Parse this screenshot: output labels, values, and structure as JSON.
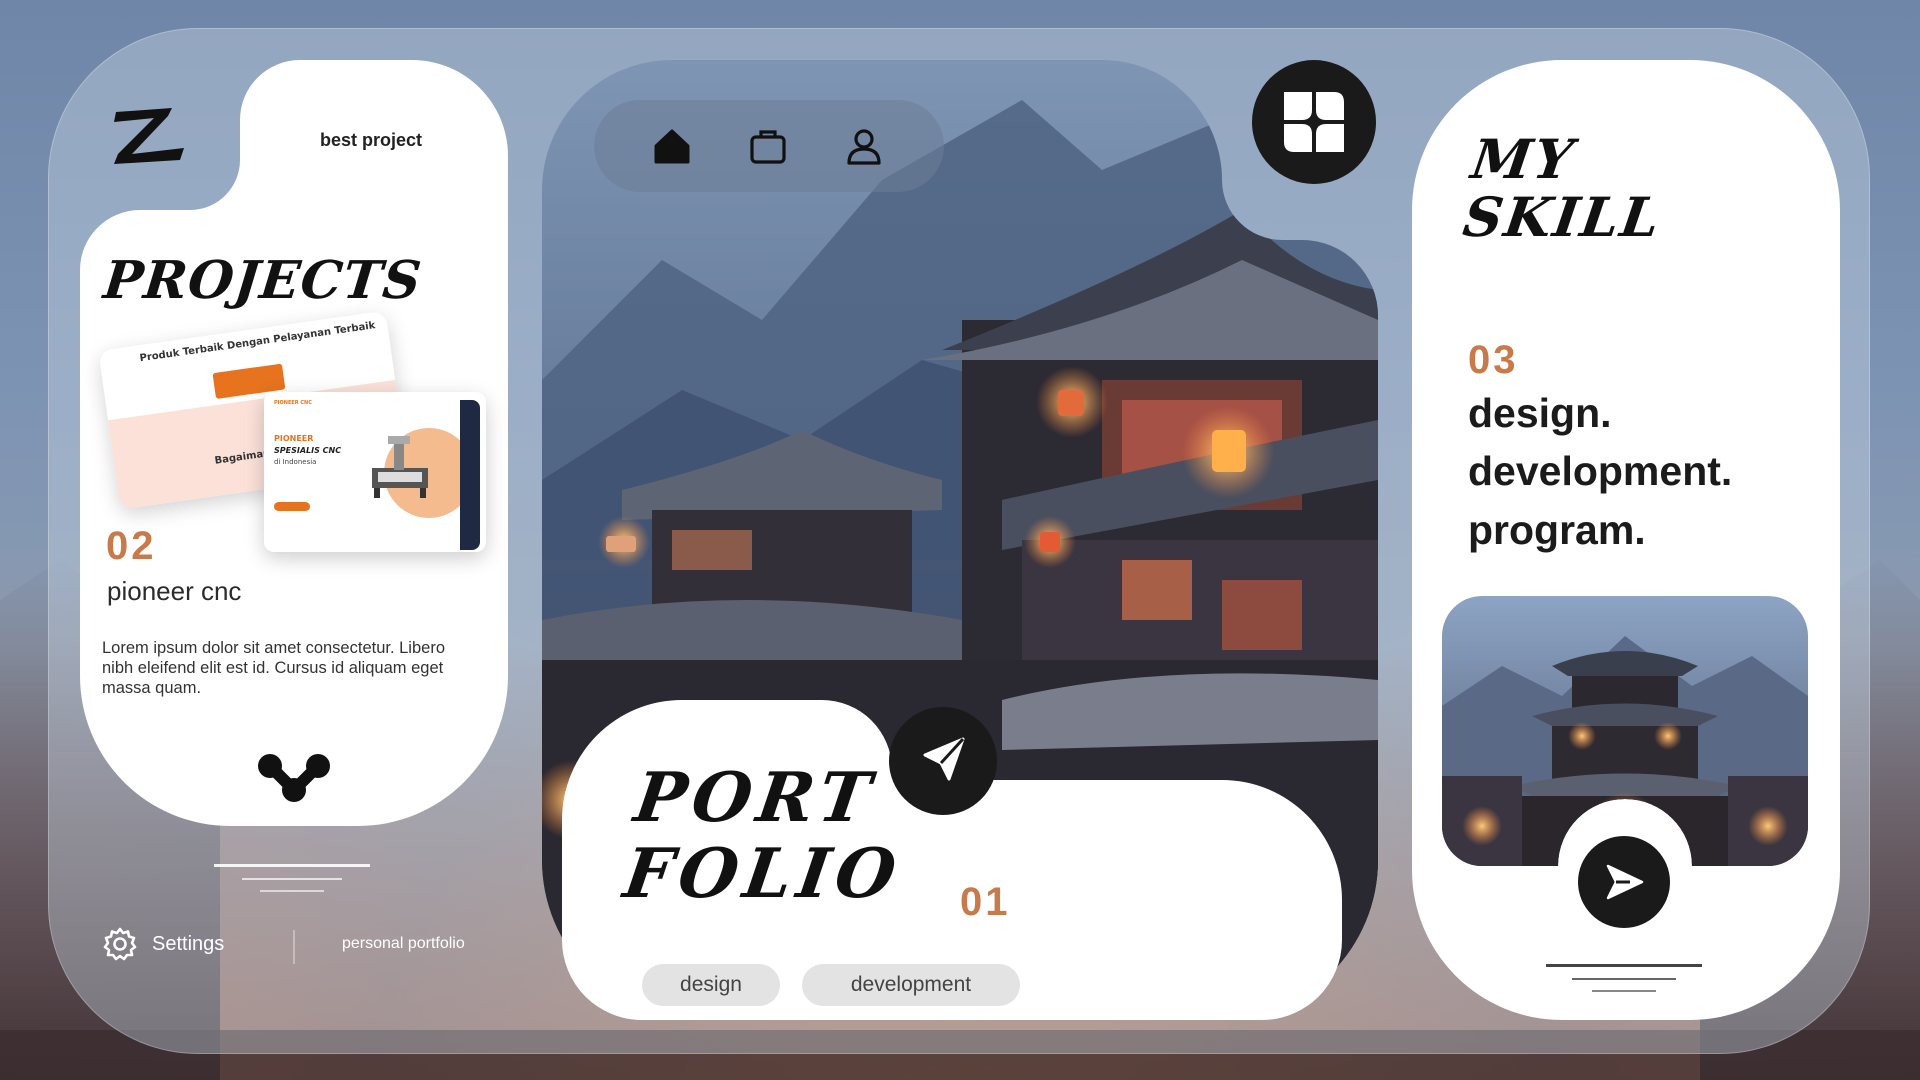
{
  "colors": {
    "accent": "#c97a4a",
    "dark": "#1a1a1a",
    "card": "#ffffff",
    "tag_bg": "#e3e3e3"
  },
  "left": {
    "logo": "Z",
    "best_project": "best project",
    "projects_title": "PROJECTS",
    "preview": {
      "mock1_heading": "Produk Terbaik Dengan Pelayanan Terbaik",
      "mock1_footer": "Bagaimana Kata M",
      "mock2_nav": "PIONEER CNC",
      "mock2_title": "PIONEER",
      "mock2_subtitle": "SPESIALIS CNC",
      "mock2_caption": "di Indonesia"
    },
    "number": "02",
    "project_name": "pioneer cnc",
    "description": "Lorem ipsum dolor sit amet consectetur. Libero nibh eleifend elit est id. Cursus id aliquam eget massa quam.",
    "icon": "molecule-icon"
  },
  "footer": {
    "settings_label": "Settings",
    "settings_icon": "gear-icon",
    "tagline": "personal portfolio"
  },
  "center": {
    "nav_icons": [
      "home-icon",
      "briefcase-icon",
      "user-icon"
    ],
    "menu_icon": "grid-logo-icon",
    "title_line1": "PORT",
    "title_line2": "FOLIO",
    "send_icon": "paper-plane-icon",
    "number": "01",
    "tags": [
      "design",
      "development"
    ]
  },
  "right": {
    "title_line1": "MY",
    "title_line2": "SKILL",
    "number": "03",
    "skills": [
      "design.",
      "development.",
      "program."
    ],
    "play_icon": "send-arrow-icon"
  }
}
